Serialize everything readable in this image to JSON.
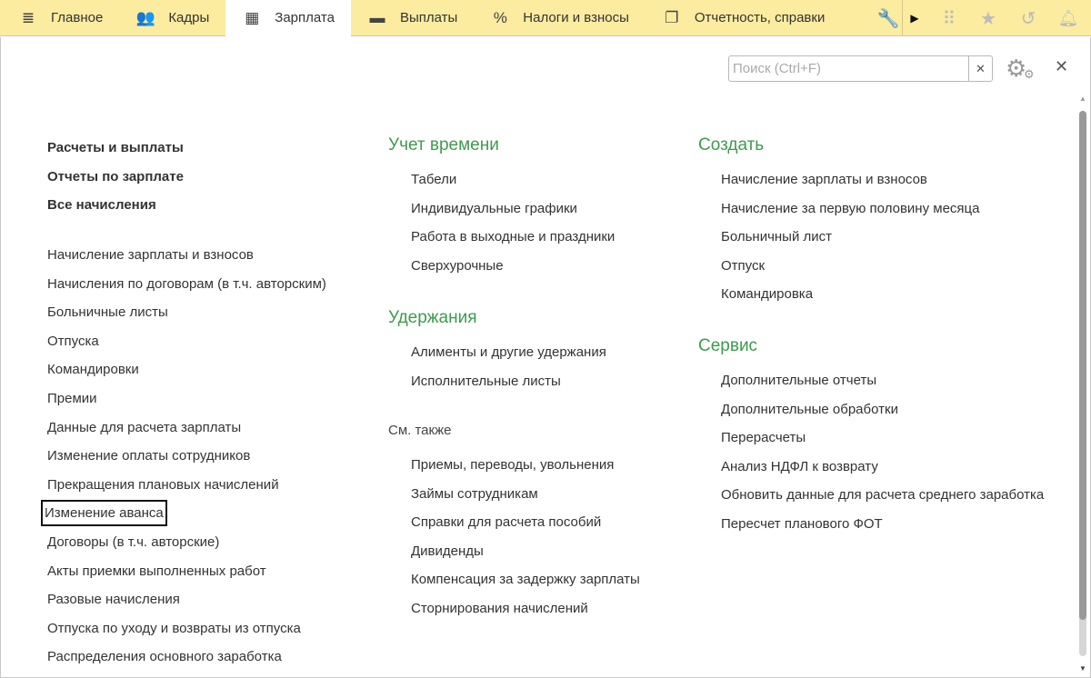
{
  "tabs": [
    {
      "label": "Главное",
      "icon": "menu-icon",
      "glyph": "≣"
    },
    {
      "label": "Кадры",
      "icon": "people-icon",
      "glyph": "👥"
    },
    {
      "label": "Зарплата",
      "icon": "calculator-icon",
      "glyph": "▦"
    },
    {
      "label": "Выплаты",
      "icon": "wallet-icon",
      "glyph": "▬"
    },
    {
      "label": "Налоги и взносы",
      "icon": "percent-icon",
      "glyph": "%"
    },
    {
      "label": "Отчетность, справки",
      "icon": "documents-icon",
      "glyph": "❐"
    }
  ],
  "search": {
    "placeholder": "Поиск (Ctrl+F)",
    "value": ""
  },
  "left": {
    "bold": [
      "Расчеты и выплаты",
      "Отчеты по зарплате",
      "Все начисления"
    ],
    "items": [
      "Начисление зарплаты и взносов",
      "Начисления по договорам (в т.ч. авторским)",
      "Больничные листы",
      "Отпуска",
      "Командировки",
      "Премии",
      "Данные для расчета зарплаты",
      "Изменение оплаты сотрудников",
      "Прекращения плановых начислений",
      "Изменение аванса",
      "Договоры (в т.ч. авторские)",
      "Акты приемки выполненных работ",
      "Разовые начисления",
      "Отпуска по уходу и возвраты из отпуска",
      "Распределения основного заработка"
    ]
  },
  "middle": {
    "time": {
      "title": "Учет времени",
      "items": [
        "Табели",
        "Индивидуальные графики",
        "Работа в выходные и праздники",
        "Сверхурочные"
      ]
    },
    "deductions": {
      "title": "Удержания",
      "items": [
        "Алименты и другие удержания",
        "Исполнительные листы"
      ]
    },
    "see_also": {
      "title": "См. также",
      "items": [
        "Приемы, переводы, увольнения",
        "Займы сотрудникам",
        "Справки для расчета пособий",
        "Дивиденды",
        "Компенсация за задержку зарплаты",
        "Сторнирования начислений"
      ]
    }
  },
  "right": {
    "create": {
      "title": "Создать",
      "items": [
        "Начисление зарплаты и взносов",
        "Начисление за первую половину месяца",
        "Больничный лист",
        "Отпуск",
        "Командировка"
      ]
    },
    "service": {
      "title": "Сервис",
      "items": [
        "Дополнительные отчеты",
        "Дополнительные обработки",
        "Перерасчеты",
        "Анализ НДФЛ к возврату",
        "Обновить данные для расчета среднего заработка",
        "Пересчет планового ФОТ"
      ]
    }
  },
  "colors": {
    "topbar": "#fbeca0",
    "heading": "#3e9a4e"
  }
}
